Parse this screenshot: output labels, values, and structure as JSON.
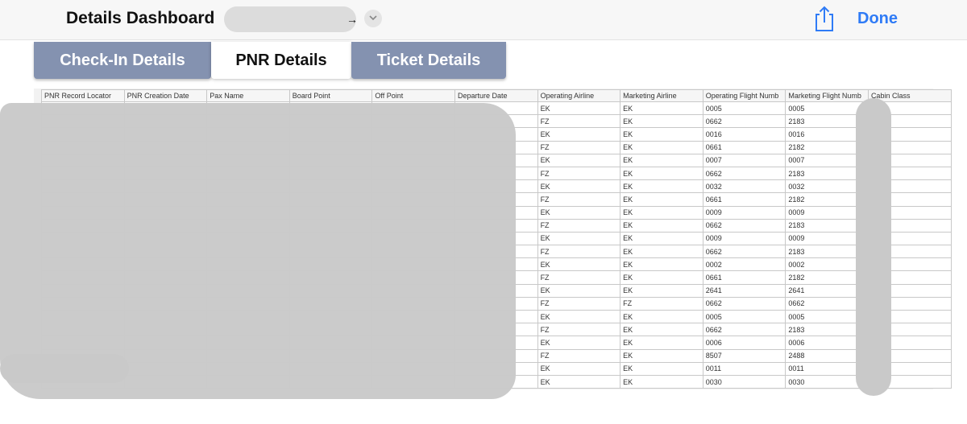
{
  "header": {
    "title": "Details Dashboard",
    "title_suffix": "→",
    "done_label": "Done",
    "share_icon": "share-icon",
    "chevron_icon": "chevron-down-icon",
    "accent_color": "#2f7bf6"
  },
  "tabs": [
    {
      "label": "Check-In Details",
      "active": false
    },
    {
      "label": "PNR Details",
      "active": true
    },
    {
      "label": "Ticket Details",
      "active": false
    }
  ],
  "table": {
    "columns": [
      "PNR Record Locator",
      "PNR Creation Date",
      "Pax Name",
      "Board Point",
      "Off Point",
      "Departure Date",
      "Operating Airline",
      "Marketing Airline",
      "Operating Flight Numb",
      "Marketing Flight Numb",
      "Cabin Class"
    ],
    "rows": [
      [
        "EK",
        "EK",
        "0005",
        "0005"
      ],
      [
        "FZ",
        "EK",
        "0662",
        "2183"
      ],
      [
        "EK",
        "EK",
        "0016",
        "0016"
      ],
      [
        "FZ",
        "EK",
        "0661",
        "2182"
      ],
      [
        "EK",
        "EK",
        "0007",
        "0007"
      ],
      [
        "FZ",
        "EK",
        "0662",
        "2183"
      ],
      [
        "EK",
        "EK",
        "0032",
        "0032"
      ],
      [
        "FZ",
        "EK",
        "0661",
        "2182"
      ],
      [
        "EK",
        "EK",
        "0009",
        "0009"
      ],
      [
        "FZ",
        "EK",
        "0662",
        "2183"
      ],
      [
        "EK",
        "EK",
        "0009",
        "0009"
      ],
      [
        "FZ",
        "EK",
        "0662",
        "2183"
      ],
      [
        "EK",
        "EK",
        "0002",
        "0002"
      ],
      [
        "FZ",
        "EK",
        "0661",
        "2182"
      ],
      [
        "EK",
        "EK",
        "2641",
        "2641"
      ],
      [
        "FZ",
        "FZ",
        "0662",
        "0662"
      ],
      [
        "EK",
        "EK",
        "0005",
        "0005"
      ],
      [
        "FZ",
        "EK",
        "0662",
        "2183"
      ],
      [
        "EK",
        "EK",
        "0006",
        "0006"
      ],
      [
        "FZ",
        "EK",
        "8507",
        "2488"
      ],
      [
        "EK",
        "EK",
        "0011",
        "0011"
      ],
      [
        "EK",
        "EK",
        "0030",
        "0030"
      ]
    ]
  }
}
